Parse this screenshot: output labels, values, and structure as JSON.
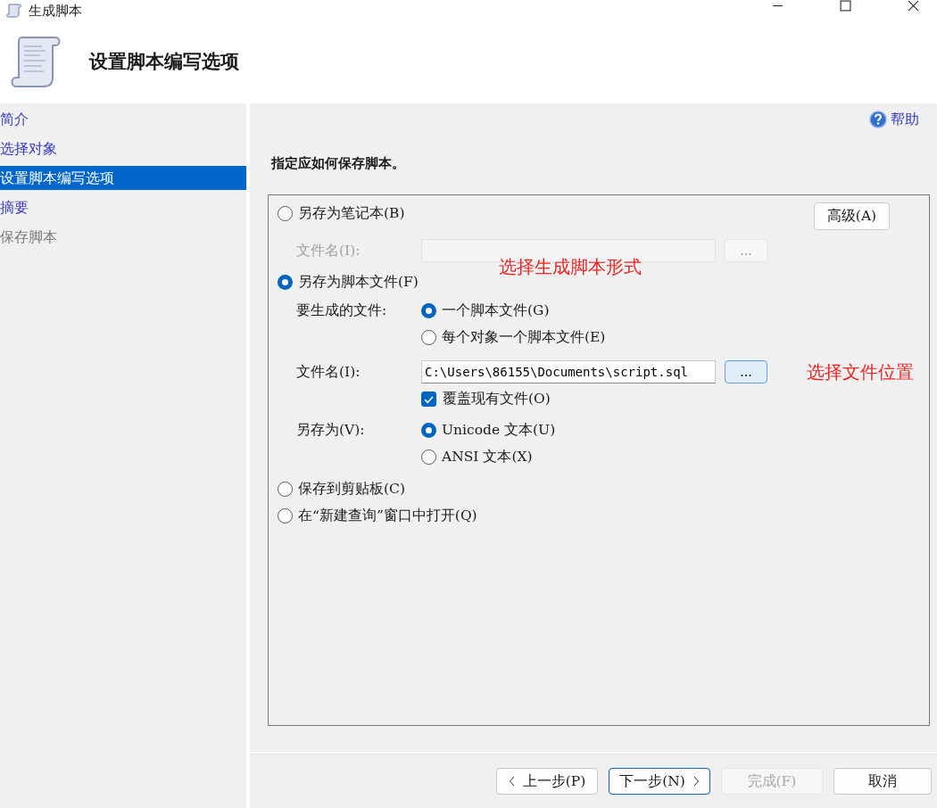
{
  "window": {
    "title": "生成脚本"
  },
  "header": {
    "title": "设置脚本编写选项"
  },
  "sidebar": {
    "items": [
      {
        "label": "简介",
        "selected": false,
        "disabled": false
      },
      {
        "label": "选择对象",
        "selected": false,
        "disabled": false
      },
      {
        "label": "设置脚本编写选项",
        "selected": true,
        "disabled": false
      },
      {
        "label": "摘要",
        "selected": false,
        "disabled": false
      },
      {
        "label": "保存脚本",
        "selected": false,
        "disabled": true
      }
    ]
  },
  "help": {
    "label": "帮助"
  },
  "instruction": "指定应如何保存脚本。",
  "advanced_button": "高级(A)",
  "save_modes": [
    {
      "kind": "notebook",
      "label": "另存为笔记本(B)",
      "selected": false
    },
    {
      "kind": "script_file",
      "label": "另存为脚本文件(F)",
      "selected": true
    },
    {
      "kind": "clipboard",
      "label": "保存到剪贴板(C)",
      "selected": false
    },
    {
      "kind": "query_window",
      "label": "在“新建查询”窗口中打开(Q)",
      "selected": false
    }
  ],
  "notebook_file": {
    "label": "文件名(I):",
    "browse": "...",
    "disabled": true
  },
  "files_to_generate": {
    "label": "要生成的文件:",
    "options": [
      {
        "label": "一个脚本文件(G)",
        "selected": true
      },
      {
        "label": "每个对象一个脚本文件(E)",
        "selected": false
      }
    ]
  },
  "script_file": {
    "label": "文件名(I):",
    "value": "C:\\Users\\86155\\Documents\\script.sql",
    "browse": "...",
    "disabled": false
  },
  "overwrite": {
    "label": "覆盖现有文件(O)",
    "checked": true
  },
  "save_as": {
    "label": "另存为(V):",
    "options": [
      {
        "label": "Unicode 文本(U)",
        "selected": true
      },
      {
        "label": "ANSI 文本(X)",
        "selected": false
      }
    ]
  },
  "annotations": [
    {
      "text": "选择生成脚本形式"
    },
    {
      "text": "选择文件位置"
    }
  ],
  "buttons": [
    {
      "kind": "back",
      "label": "上一步(P)",
      "disabled": false,
      "focused": false
    },
    {
      "kind": "next",
      "label": "下一步(N)",
      "disabled": false,
      "focused": true
    },
    {
      "kind": "finish",
      "label": "完成(F)",
      "disabled": true,
      "focused": false
    },
    {
      "kind": "cancel",
      "label": "取消",
      "disabled": false,
      "focused": false
    }
  ]
}
